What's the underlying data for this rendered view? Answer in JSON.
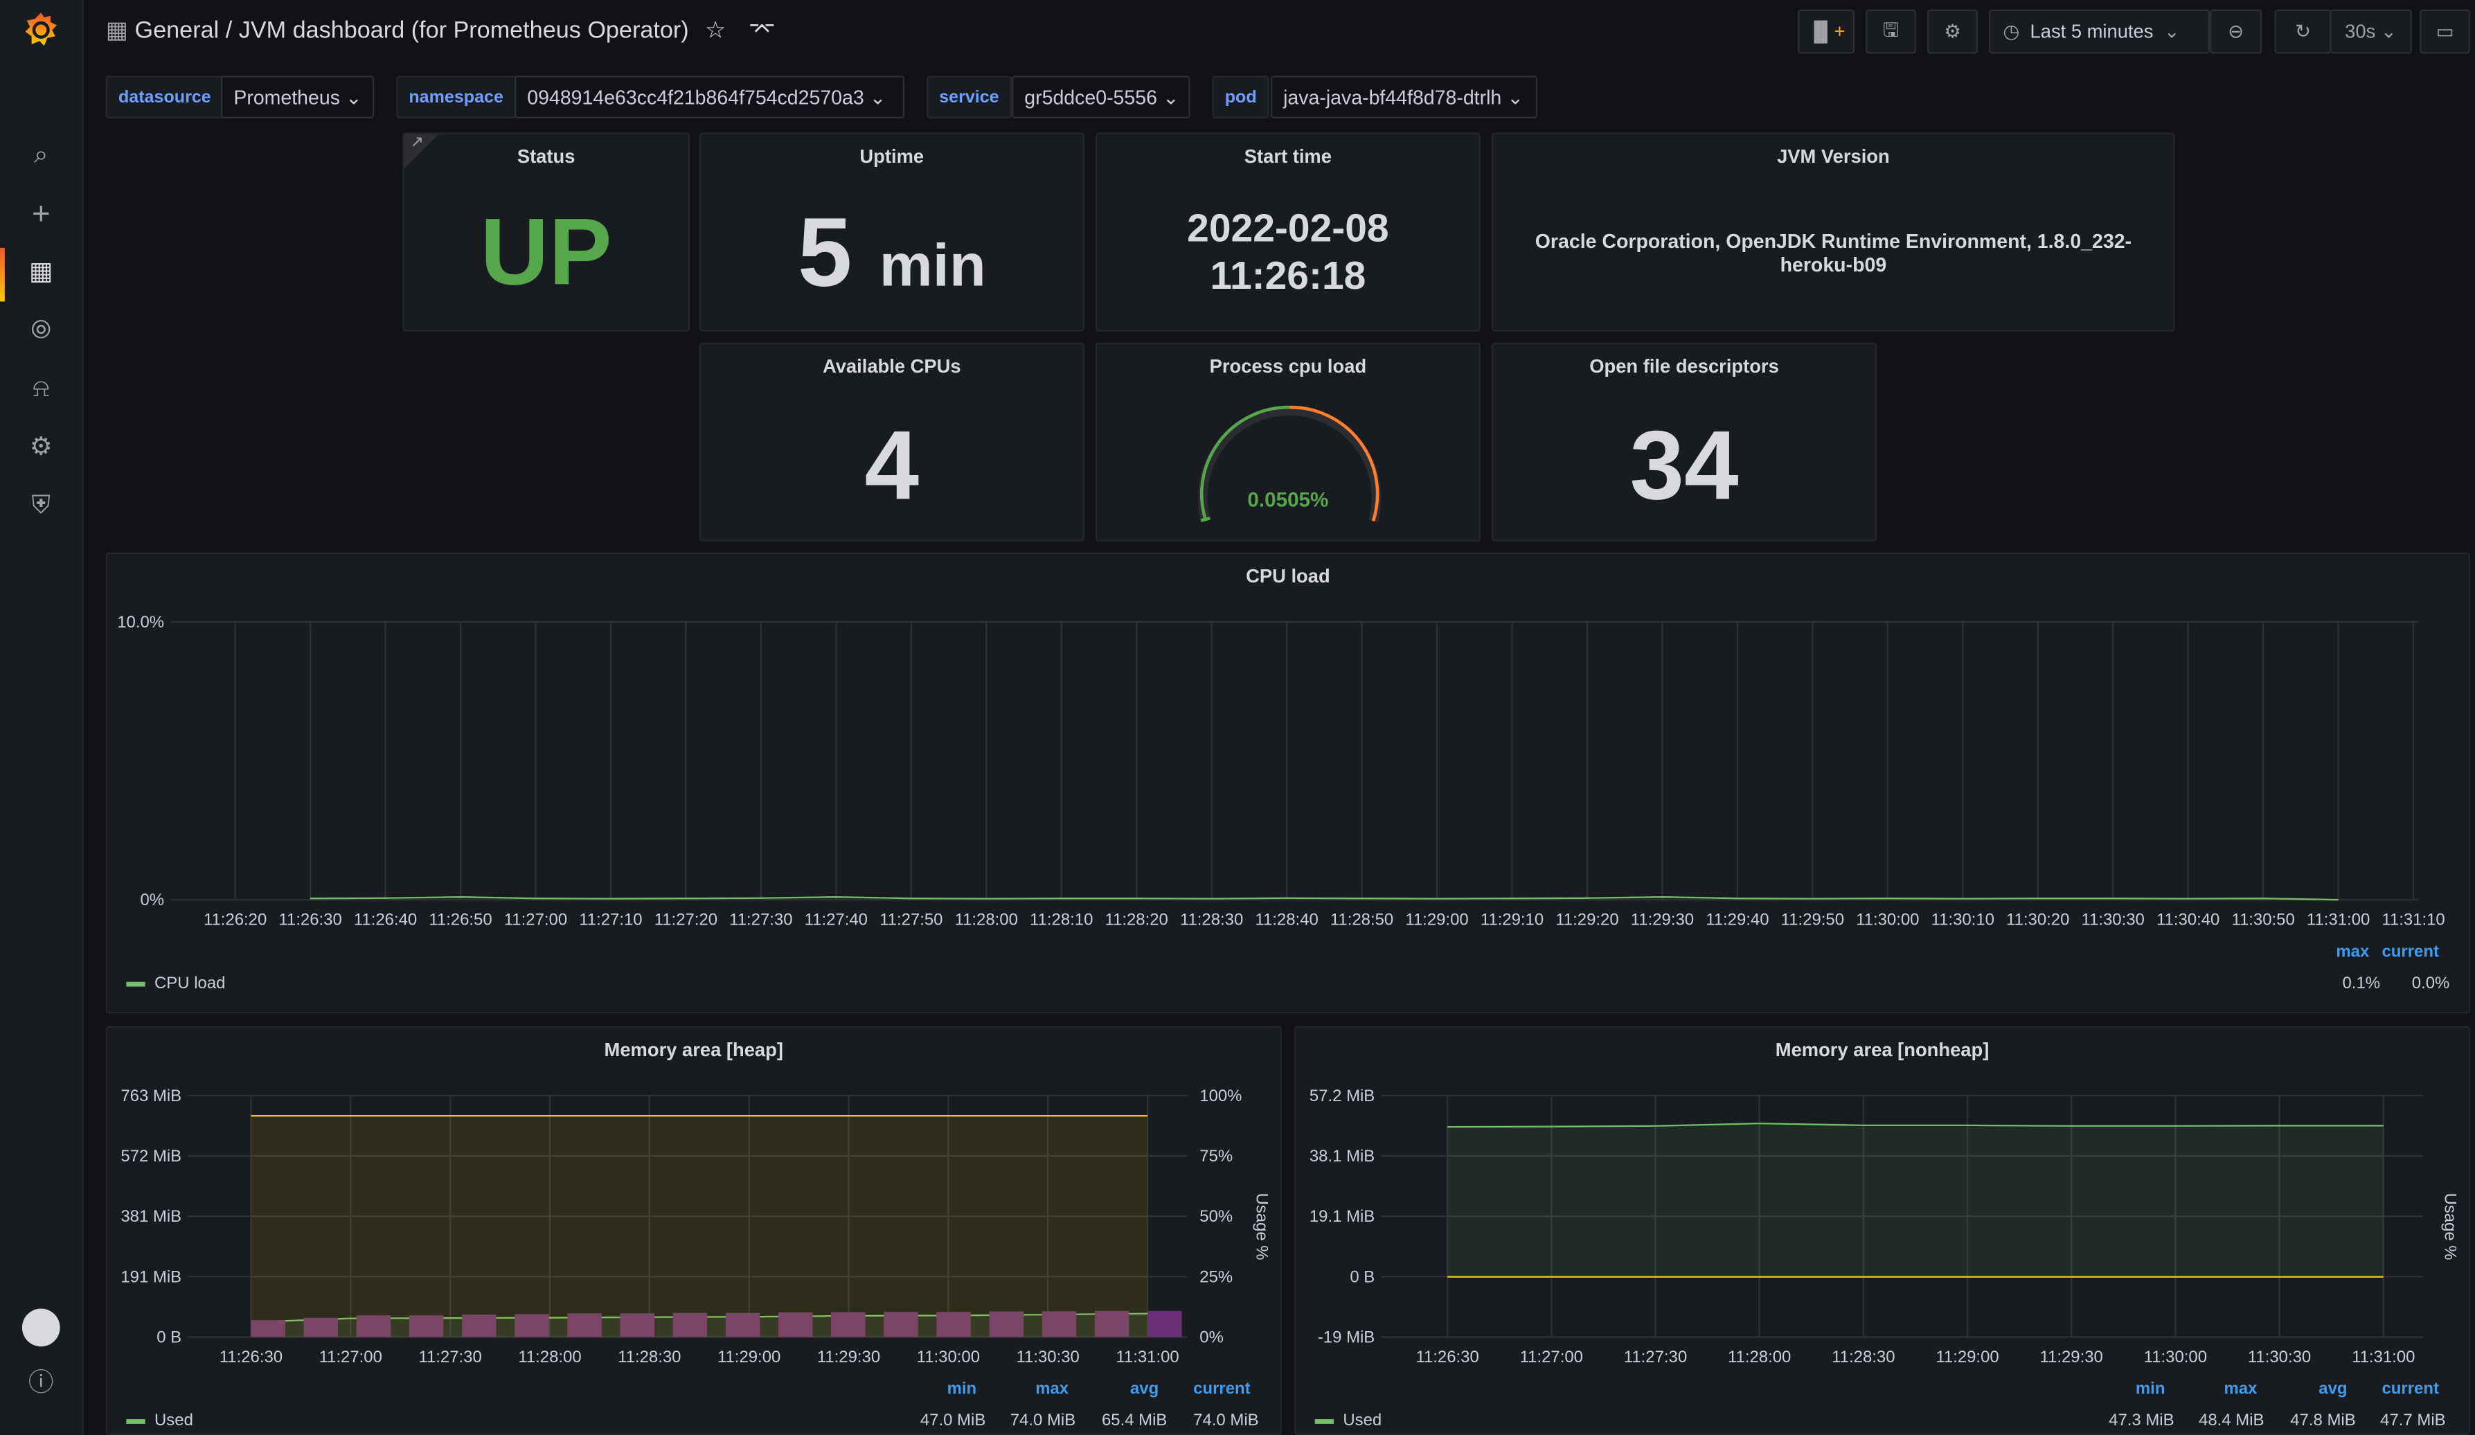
{
  "header": {
    "folder": "General",
    "separator": "/",
    "title": "JVM dashboard (for Prometheus Operator)",
    "time_range": "Last 5 minutes",
    "refresh": "30s"
  },
  "colors": {
    "accent": "#6e9fff",
    "green": "#56a64b",
    "yellow": "#f2cc0c",
    "purple": "#a352cc",
    "legend_head": "#3d9df3"
  },
  "sidebar": {
    "items": [
      "search-icon",
      "plus-icon",
      "dashboards-icon",
      "explore-icon",
      "alerting-icon",
      "configuration-icon",
      "server-admin-icon"
    ],
    "active": "dashboards-icon"
  },
  "variables": [
    {
      "label": "datasource",
      "value": "Prometheus"
    },
    {
      "label": "namespace",
      "value": "0948914e63cc4f21b864f754cd2570a3"
    },
    {
      "label": "service",
      "value": "gr5ddce0-5556"
    },
    {
      "label": "pod",
      "value": "java-java-bf44f8d78-dtrlh"
    }
  ],
  "stats": {
    "status": {
      "title": "Status",
      "value": "UP"
    },
    "uptime": {
      "title": "Uptime",
      "value": "5",
      "unit": "min"
    },
    "start_time": {
      "title": "Start time",
      "date": "2022-02-08",
      "time": "11:26:18"
    },
    "jvm_version": {
      "title": "JVM Version",
      "value": "Oracle Corporation, OpenJDK Runtime Environment, 1.8.0_232-heroku-b09"
    },
    "cpus": {
      "title": "Available CPUs",
      "value": "4"
    },
    "cpu_load": {
      "title": "Process cpu load",
      "value": "0.0505%",
      "fraction": 0.000505
    },
    "fds": {
      "title": "Open file descriptors",
      "value": "34"
    }
  },
  "chart_data": [
    {
      "type": "line",
      "title": "CPU load",
      "x": [
        "11:26:20",
        "11:26:30",
        "11:26:40",
        "11:26:50",
        "11:27:00",
        "11:27:10",
        "11:27:20",
        "11:27:30",
        "11:27:40",
        "11:27:50",
        "11:28:00",
        "11:28:10",
        "11:28:20",
        "11:28:30",
        "11:28:40",
        "11:28:50",
        "11:29:00",
        "11:29:10",
        "11:29:20",
        "11:29:30",
        "11:29:40",
        "11:29:50",
        "11:30:00",
        "11:30:10",
        "11:30:20",
        "11:30:30",
        "11:30:40",
        "11:30:50",
        "11:31:00",
        "11:31:10"
      ],
      "yticks": [
        "10.0%",
        "0%"
      ],
      "ylim": [
        0,
        10
      ],
      "series": [
        {
          "name": "CPU load",
          "color": "#73bf69",
          "values": [
            null,
            0.05,
            0.06,
            0.1,
            0.05,
            0.04,
            0.05,
            0.06,
            0.1,
            0.05,
            0.04,
            0.05,
            0.05,
            0.04,
            0.06,
            0.05,
            0.04,
            0.05,
            0.06,
            0.1,
            0.05,
            0.04,
            0.05,
            0.04,
            0.05,
            0.05,
            0.04,
            0.05,
            0.0,
            null
          ]
        }
      ],
      "legend": {
        "headers": [
          "max",
          "current"
        ],
        "rows": [
          {
            "name": "CPU load",
            "values": [
              "0.1%",
              "0.0%"
            ]
          }
        ]
      }
    },
    {
      "type": "line",
      "title": "Memory area [heap]",
      "x": [
        "11:26:30",
        "11:27:00",
        "11:27:30",
        "11:28:00",
        "11:28:30",
        "11:29:00",
        "11:29:30",
        "11:30:00",
        "11:30:30",
        "11:31:00"
      ],
      "yticks": [
        "763 MiB",
        "572 MiB",
        "381 MiB",
        "191 MiB",
        "0 B"
      ],
      "ylim": [
        0,
        763
      ],
      "y2ticks": [
        "100%",
        "75%",
        "50%",
        "25%",
        "0%"
      ],
      "y2label": "Usage %",
      "series": [
        {
          "name": "Used",
          "color": "#73bf69",
          "values": [
            47,
            59,
            60,
            61,
            63,
            64,
            67,
            68,
            71,
            74
          ]
        },
        {
          "color": "#f2cc0c",
          "values": [
            699,
            699,
            699,
            699,
            699,
            699,
            699,
            699,
            699,
            699
          ]
        },
        {
          "color": "#a352cc",
          "axis": "right",
          "bars": [
            7,
            8,
            9,
            9,
            9.3,
            9.5,
            9.8,
            9.8,
            10,
            10,
            10.2,
            10.3,
            10.4,
            10.4,
            10.6,
            10.7,
            10.8,
            10.8
          ]
        }
      ],
      "legend": {
        "headers": [
          "min",
          "max",
          "avg",
          "current"
        ],
        "rows": [
          {
            "name": "Used",
            "values": [
              "47.0 MiB",
              "74.0 MiB",
              "65.4 MiB",
              "74.0 MiB"
            ]
          }
        ]
      }
    },
    {
      "type": "line",
      "title": "Memory area [nonheap]",
      "x": [
        "11:26:30",
        "11:27:00",
        "11:27:30",
        "11:28:00",
        "11:28:30",
        "11:29:00",
        "11:29:30",
        "11:30:00",
        "11:30:30",
        "11:31:00"
      ],
      "yticks": [
        "57.2 MiB",
        "38.1 MiB",
        "19.1 MiB",
        "0 B",
        "-19 MiB"
      ],
      "ylim": [
        -19,
        57.2
      ],
      "y2label": "Usage %",
      "series": [
        {
          "name": "Used",
          "color": "#73bf69",
          "values": [
            47.3,
            47.4,
            47.6,
            48.4,
            47.8,
            47.8,
            47.6,
            47.6,
            47.7,
            47.7
          ]
        },
        {
          "color": "#f2cc0c",
          "values": [
            0,
            0,
            0,
            0,
            0,
            0,
            0,
            0,
            0,
            0
          ]
        }
      ],
      "legend": {
        "headers": [
          "min",
          "max",
          "avg",
          "current"
        ],
        "rows": [
          {
            "name": "Used",
            "values": [
              "47.3 MiB",
              "48.4 MiB",
              "47.8 MiB",
              "47.7 MiB"
            ]
          }
        ]
      }
    }
  ]
}
